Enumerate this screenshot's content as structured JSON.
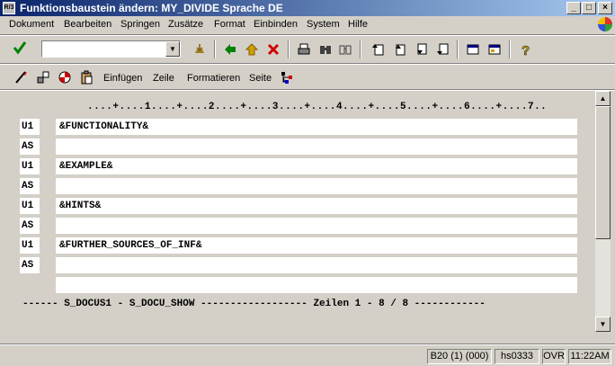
{
  "window": {
    "title": "Funktionsbaustein ändern: MY_DIVIDE Sprache DE",
    "app_icon_text": "R/3"
  },
  "menu": [
    {
      "label": "Dokument"
    },
    {
      "label": "Bearbeiten"
    },
    {
      "label": "Springen"
    },
    {
      "label": "Zusätze"
    },
    {
      "label": "Format"
    },
    {
      "label": "Einbinden"
    },
    {
      "label": "System"
    },
    {
      "label": "Hilfe"
    }
  ],
  "command_field": {
    "value": ""
  },
  "app_toolbar": {
    "insert_label": "Einfügen",
    "line_label": "Zeile",
    "format_label": "Formatieren",
    "page_label": "Seite"
  },
  "editor": {
    "ruler": "....+....1....+....2....+....3....+....4....+....5....+....6....+....7..",
    "rows": [
      {
        "tag": "U1",
        "text": "&FUNCTIONALITY&"
      },
      {
        "tag": "AS",
        "text": ""
      },
      {
        "tag": "U1",
        "text": "&EXAMPLE&"
      },
      {
        "tag": "AS",
        "text": ""
      },
      {
        "tag": "U1",
        "text": "&HINTS&"
      },
      {
        "tag": "AS",
        "text": ""
      },
      {
        "tag": "U1",
        "text": "&FURTHER_SOURCES_OF_INF&"
      },
      {
        "tag": "AS",
        "text": ""
      },
      {
        "tag": "",
        "text": ""
      }
    ],
    "footer": "------ S_DOCUS1 - S_DOCU_SHOW ------------------ Zeilen 1 - 8 / 8 ------------"
  },
  "status": {
    "session": "B20 (1) (000)",
    "server": "hs0333",
    "mode": "OVR",
    "time": "11:22AM"
  },
  "colors": {
    "title_gradient_start": "#0a246a",
    "title_gradient_end": "#a6caf0",
    "window_bg": "#d4d0c8",
    "field_bg": "#ffffff"
  }
}
